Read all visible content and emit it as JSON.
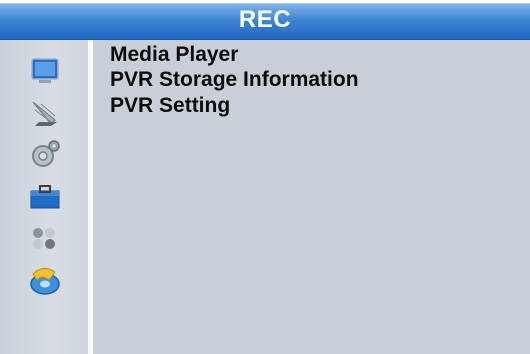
{
  "header": {
    "title": "REC"
  },
  "menu": {
    "items": [
      {
        "label": "Media Player"
      },
      {
        "label": "PVR Storage Information"
      },
      {
        "label": "PVR Setting"
      }
    ]
  },
  "sidebar": {
    "icons": [
      {
        "name": "tv-icon"
      },
      {
        "name": "satellite-dish-icon"
      },
      {
        "name": "settings-gear-icon"
      },
      {
        "name": "toolbox-icon"
      },
      {
        "name": "games-icon"
      },
      {
        "name": "record-disc-icon",
        "selected": true
      }
    ]
  },
  "colors": {
    "title_bar": "#3f86d6",
    "content_bg": "#c8cfd8",
    "sidebar_bg": "#d4d9e0",
    "text": "#0c0c0c"
  }
}
